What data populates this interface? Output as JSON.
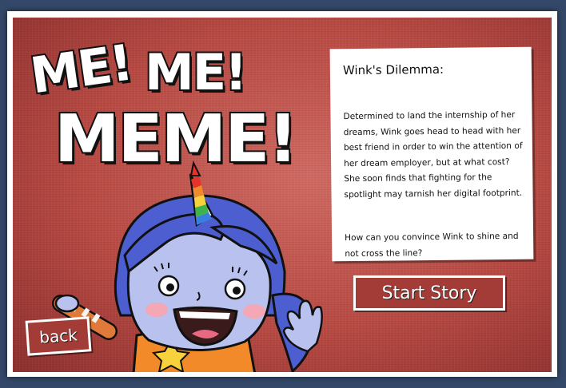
{
  "title": {
    "line1_word1": "ME!",
    "line1_word2": "ME!",
    "line2": "MEME!"
  },
  "story_card": {
    "heading": "Wink's Dilemma:",
    "body": "Determined to land the internship of her dreams, Wink goes head to head with her best friend in order to win the attention of her dream employer, but at what cost? She soon finds that fighting for the spotlight may tarnish her digital footprint.",
    "question": "How can you convince Wink to shine and not cross the line?"
  },
  "buttons": {
    "start": "Start Story",
    "back": "back"
  },
  "colors": {
    "background_red": "#b94a43",
    "frame_blue": "#34496a",
    "character_hair": "#4d5fd0",
    "character_skin": "#b9c2ef"
  },
  "icons": {
    "character": "unicorn-girl-illustration"
  }
}
